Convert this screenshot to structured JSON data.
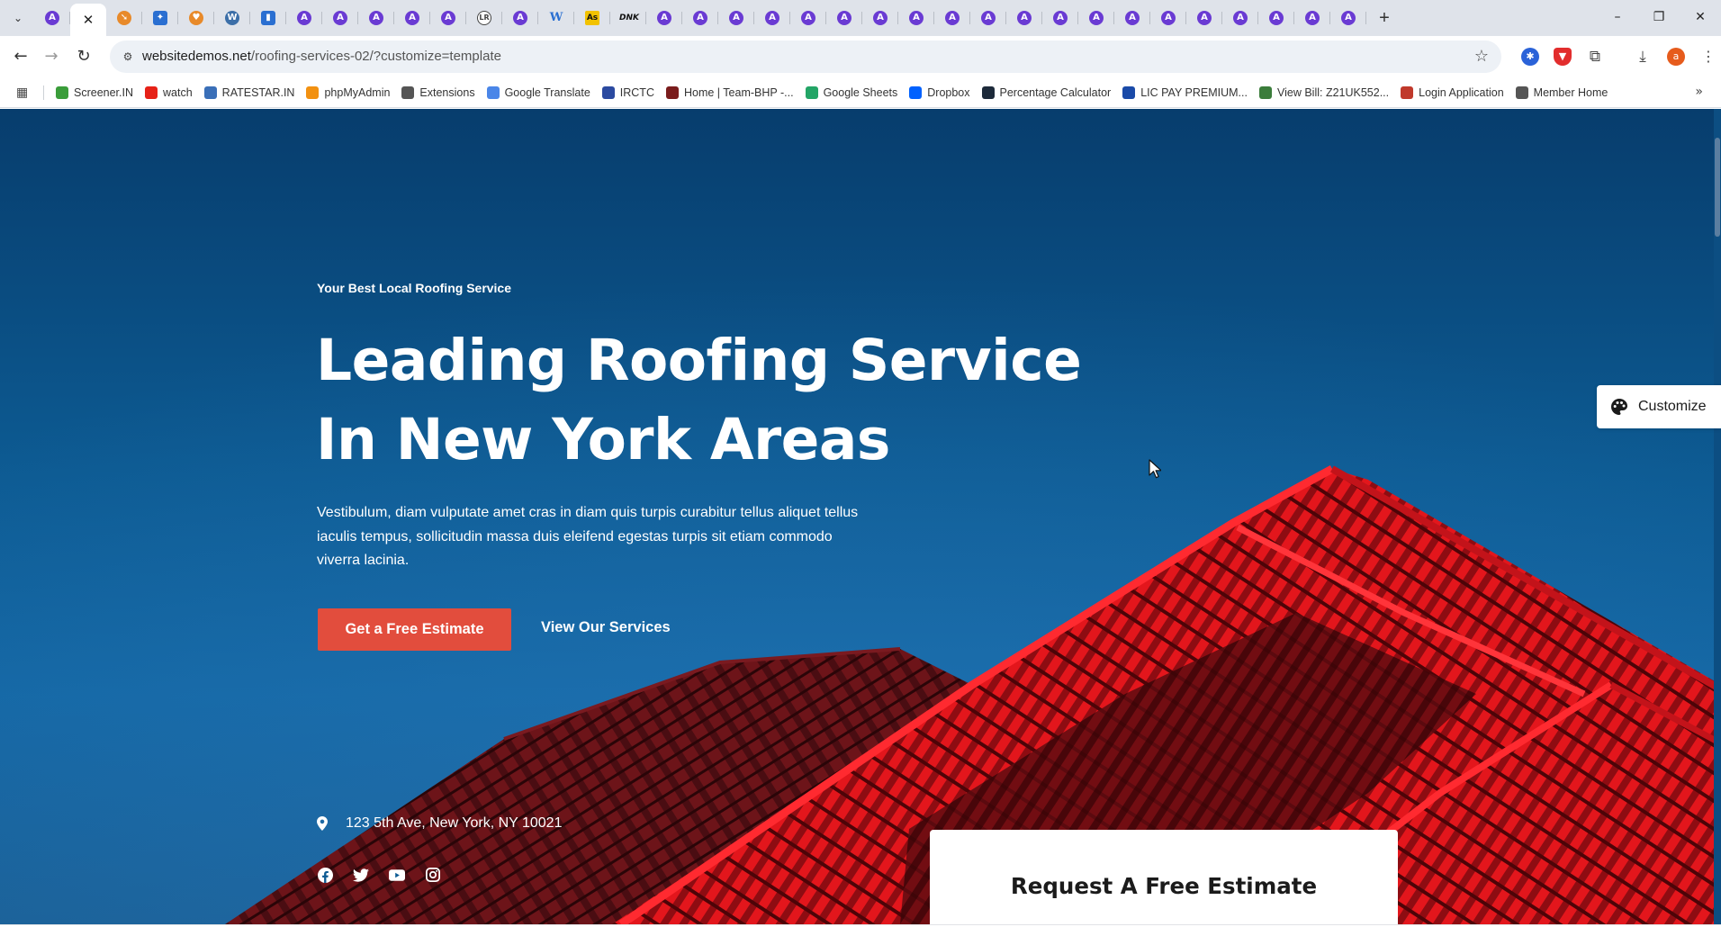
{
  "browser": {
    "active_tab_close": "✕",
    "new_tab": "+",
    "window": {
      "minimize": "–",
      "restore": "❐",
      "close": "✕"
    },
    "url_host": "websitedemos.net",
    "url_path": "/roofing-services-02/?customize=template",
    "profile_initial": "a"
  },
  "bookmarks": [
    {
      "label": "Screener.IN",
      "icon": "bar-chart-icon",
      "color": "#3a9d3a"
    },
    {
      "label": "watch",
      "icon": "youtube-icon",
      "color": "#e62117"
    },
    {
      "label": "RATESTAR.IN",
      "icon": "star-icon",
      "color": "#3a6fb8"
    },
    {
      "label": "phpMyAdmin",
      "icon": "sail-icon",
      "color": "#f29111"
    },
    {
      "label": "Extensions",
      "icon": "puzzle-icon",
      "color": "#555555"
    },
    {
      "label": "Google Translate",
      "icon": "translate-icon",
      "color": "#4a86e8"
    },
    {
      "label": "IRCTC",
      "icon": "train-icon",
      "color": "#2b4aa0"
    },
    {
      "label": "Home | Team-BHP -...",
      "icon": "team-bhp-icon",
      "color": "#7a1c1c"
    },
    {
      "label": "Google Sheets",
      "icon": "sheets-icon",
      "color": "#23a566"
    },
    {
      "label": "Dropbox",
      "icon": "dropbox-icon",
      "color": "#0061fe"
    },
    {
      "label": "Percentage Calculator",
      "icon": "percent-icon",
      "color": "#1d2a3a"
    },
    {
      "label": "LIC PAY PREMIUM...",
      "icon": "lic-icon",
      "color": "#1a4aa8"
    },
    {
      "label": "View Bill: Z21UK552...",
      "icon": "bill-icon",
      "color": "#3b7d3b"
    },
    {
      "label": "Login Application",
      "icon": "login-icon",
      "color": "#c0392b"
    },
    {
      "label": "Member Home",
      "icon": "globe-icon",
      "color": "#555555"
    }
  ],
  "hero": {
    "eyebrow": "Your Best Local Roofing Service",
    "headline_line1": "Leading Roofing Service",
    "headline_line2": "In New York Areas",
    "lead": "Vestibulum, diam vulputate amet cras in diam quis turpis curabitur tellus aliquet tellus iaculis tempus, sollicitudin massa duis eleifend egestas turpis sit etiam commodo viverra lacinia.",
    "cta_primary": "Get a Free Estimate",
    "cta_secondary": "View Our Services",
    "address": "123 5th Ave, New York, NY 10021",
    "socials": [
      "facebook-icon",
      "twitter-icon",
      "youtube-icon",
      "instagram-icon"
    ]
  },
  "estimate_card": {
    "title": "Request A Free Estimate"
  },
  "customize": {
    "label": "Customize"
  },
  "colors": {
    "accent": "#e24d3d",
    "sky_top": "#073d6d",
    "sky_bottom": "#1467a4",
    "roof_red": "#d91a1a"
  }
}
